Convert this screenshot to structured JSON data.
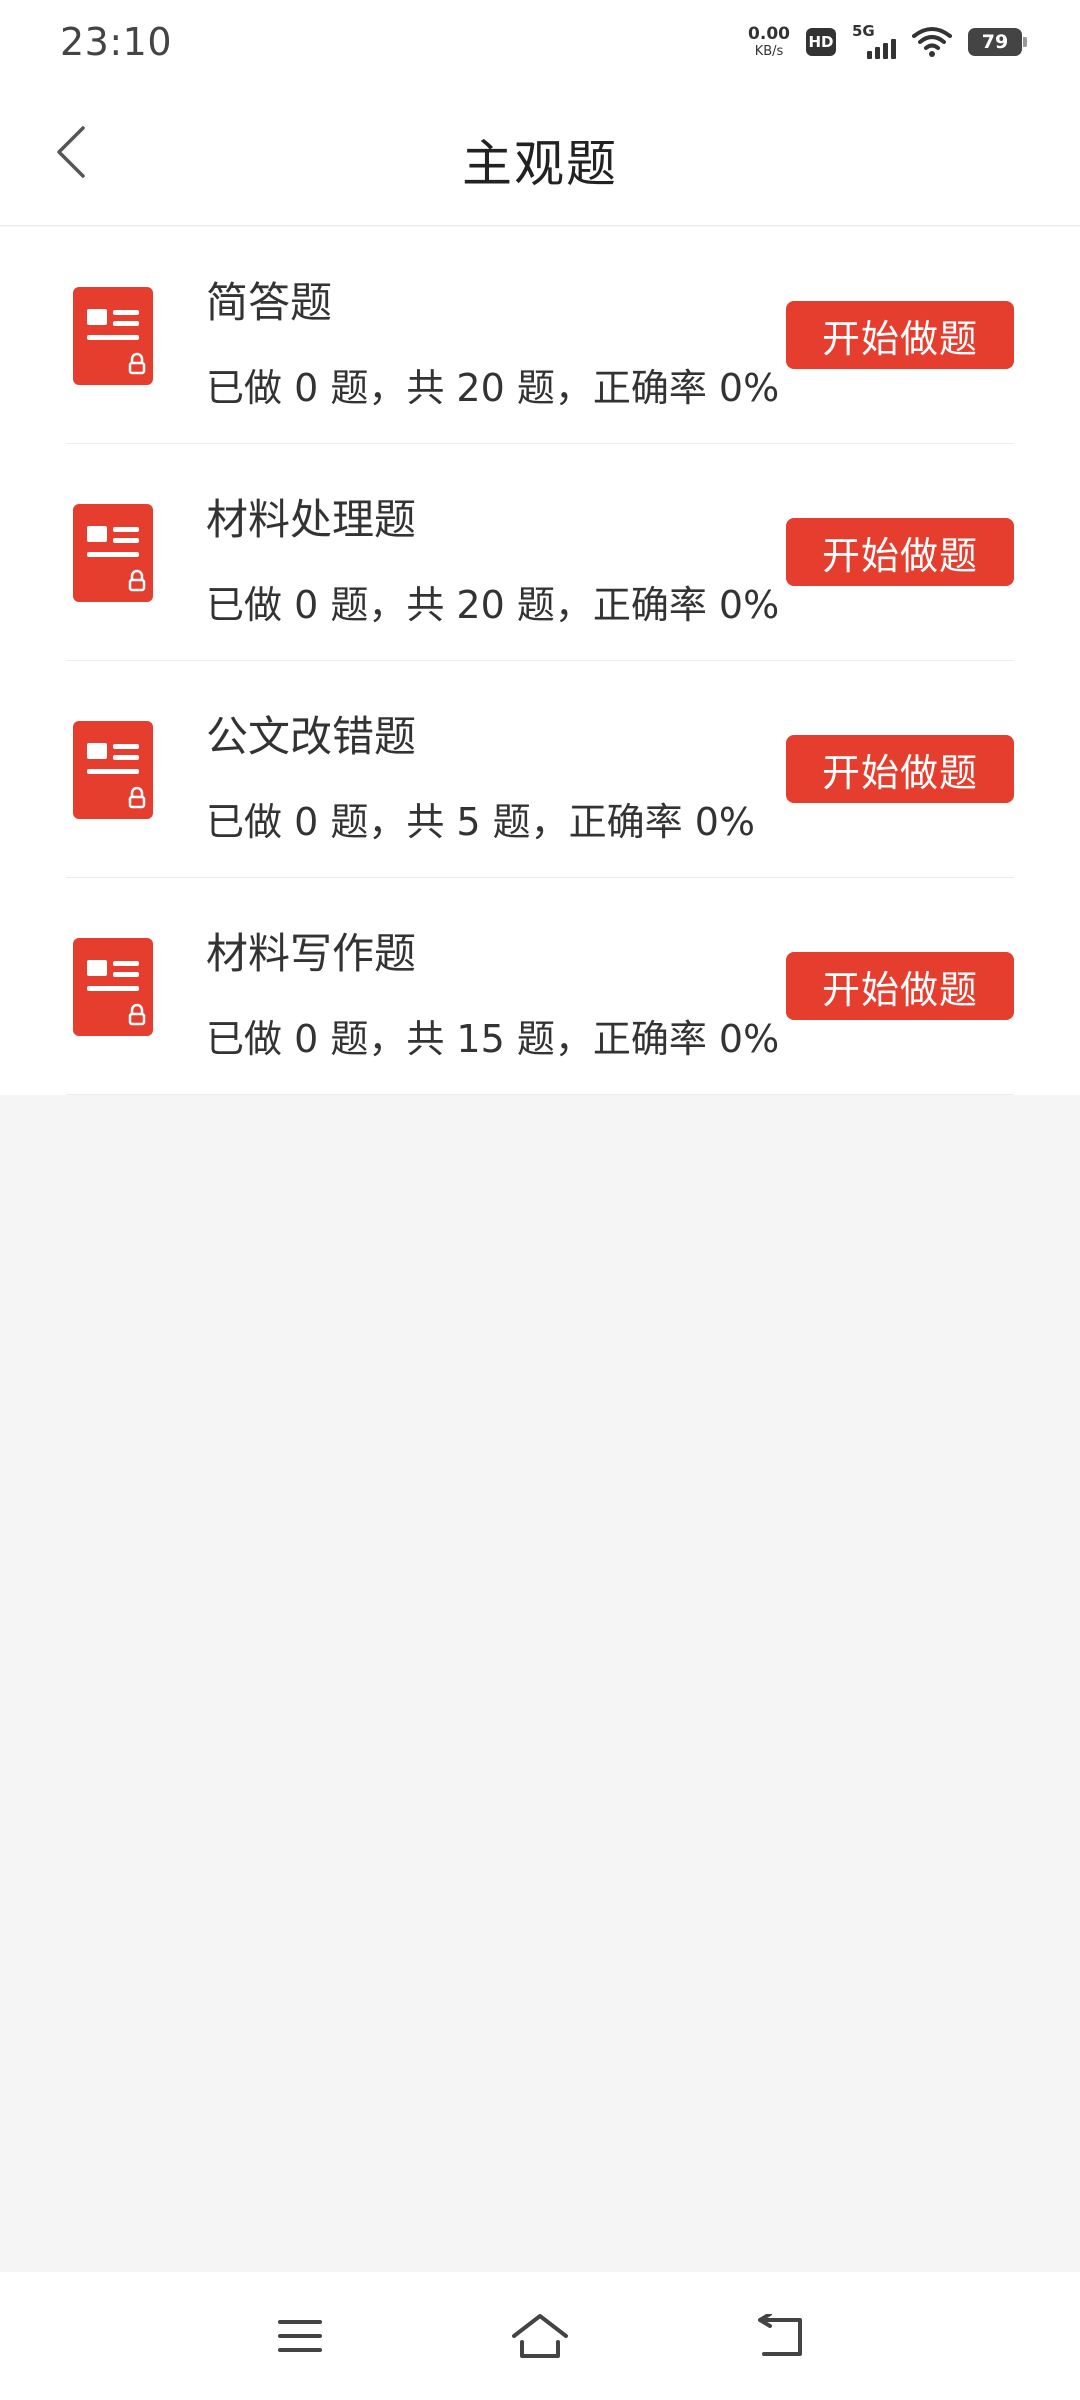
{
  "status_bar": {
    "time": "23:10",
    "net_speed_value": "0.00",
    "net_speed_unit": "KB/s",
    "hd_label": "HD",
    "network_label": "5G",
    "battery_level": "79"
  },
  "header": {
    "title": "主观题",
    "back_icon": "chevron-left-icon"
  },
  "items": [
    {
      "title": "简答题",
      "stats": "已做 0 题，共 20 题，正确率 0%",
      "button": "开始做题"
    },
    {
      "title": "材料处理题",
      "stats": "已做 0 题，共 20 题，正确率 0%",
      "button": "开始做题"
    },
    {
      "title": "公文改错题",
      "stats": "已做 0 题，共 5 题，正确率 0%",
      "button": "开始做题"
    },
    {
      "title": "材料写作题",
      "stats": "已做 0 题，共 15 题，正确率 0%",
      "button": "开始做题"
    }
  ],
  "colors": {
    "accent": "#e53e2e",
    "background": "#f5f5f5"
  },
  "nav_bar": {
    "menu_icon": "menu-icon",
    "home_icon": "home-icon",
    "back_icon": "back-icon"
  }
}
